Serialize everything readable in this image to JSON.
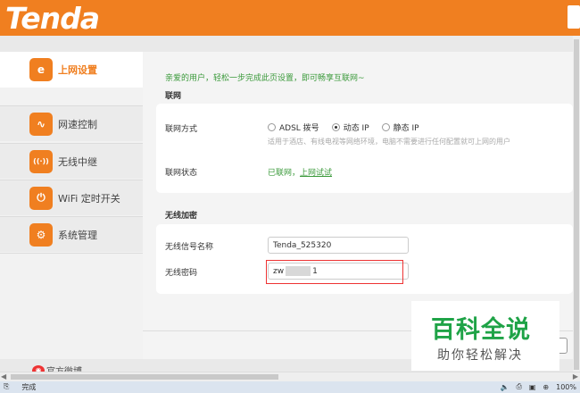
{
  "header": {
    "logo": "Tenda"
  },
  "sidebar": {
    "items": [
      {
        "label": "上网设置",
        "icon": "internet-e-icon",
        "glyph": "e",
        "active": true
      },
      {
        "label": "网速控制",
        "icon": "speed-wave-icon",
        "glyph": "∿",
        "active": false
      },
      {
        "label": "无线中继",
        "icon": "repeater-antenna-icon",
        "glyph": "((·))",
        "active": false
      },
      {
        "label": "WiFi 定时开关",
        "icon": "wifi-timer-icon",
        "glyph": "⏻",
        "active": false
      },
      {
        "label": "系统管理",
        "icon": "system-gear-icon",
        "glyph": "⚙",
        "active": false
      }
    ],
    "weibo": {
      "label": "官方微博",
      "icon": "weibo-icon"
    }
  },
  "main": {
    "welcome": "亲爱的用户，轻松一步完成此页设置，即可畅享互联网~",
    "internet": {
      "title": "联网",
      "mode_label": "联网方式",
      "options": [
        "ADSL 拨号",
        "动态 IP",
        "静态 IP"
      ],
      "selected": "动态 IP",
      "hint": "适用于酒店、有线电视等网络环境，电脑不需要进行任何配置就可上网的用户",
      "status_label": "联网状态",
      "status_text": "已联网，",
      "status_link": "上网试试"
    },
    "wireless": {
      "title": "无线加密",
      "ssid_label": "无线信号名称",
      "ssid_value": "Tenda_525320",
      "pwd_label": "无线密码",
      "pwd_prefix": "zw",
      "pwd_suffix": "1"
    }
  },
  "watermark": {
    "title": "百科全说",
    "subtitle": "助你轻松解决"
  },
  "statusbar": {
    "left": "完成",
    "zoom": "100%"
  },
  "colors": {
    "brand_orange": "#f07f20",
    "status_green": "#3b9a3b",
    "highlight_red": "#e33333"
  }
}
